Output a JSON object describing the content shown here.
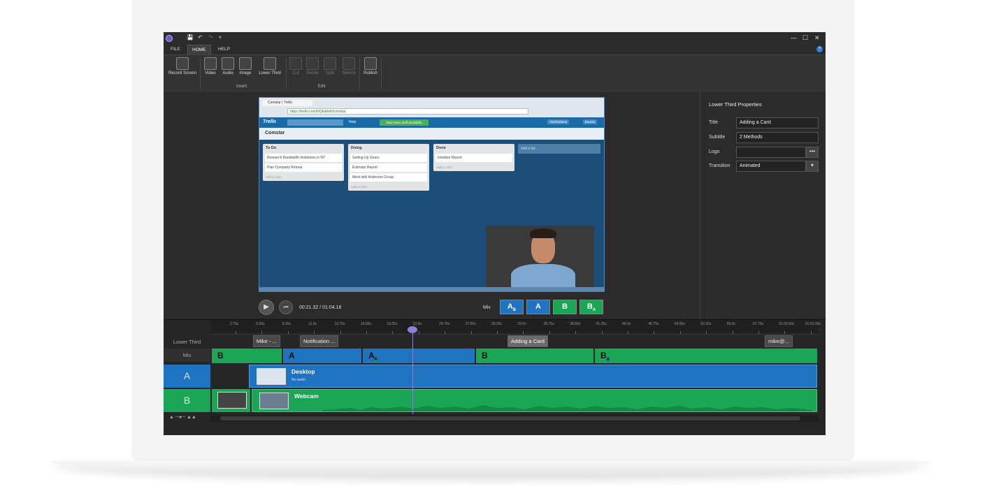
{
  "window": {
    "quick_access": [
      "💾",
      "↶",
      "↷",
      "▾"
    ],
    "controls": {
      "minimize": "—",
      "maximize": "☐",
      "close": "✕"
    }
  },
  "menu": {
    "file": "FILE",
    "home": "HOME",
    "help": "HELP",
    "help_icon": "?"
  },
  "ribbon": {
    "record_screen": "Record Screen",
    "video": "Video",
    "audio": "Audio",
    "image": "Image",
    "lower_third": "Lower Third",
    "cut": "Cut",
    "delete": "Delete",
    "split": "Split",
    "silence": "Silence",
    "publish": "Publish",
    "group_insert": "Insert",
    "group_edit": "Edit"
  },
  "preview": {
    "browser_tab": "Comstar | Trello",
    "url": "https://trello.com/b/QkddelIi/comstar",
    "trello_logo": "Trello",
    "help": "Help",
    "start_badge": "Start (New stuff available)",
    "notifications": "Notifications",
    "boards": "Boards",
    "board_name": "Comstar",
    "lists": [
      {
        "title": "To Do",
        "cards": [
          "Research Bandwidth limitations in NY",
          "Plan Company Retreat"
        ],
        "add": "Add a card..."
      },
      {
        "title": "Doing",
        "cards": [
          "Setting Up Gears",
          "Estimate Report",
          "Meet with Anderson Group"
        ],
        "add": "Add a card..."
      },
      {
        "title": "Done",
        "cards": [
          "Initiative Report"
        ],
        "add": "Add a card..."
      }
    ],
    "add_list": "Add a list..."
  },
  "transport": {
    "play_icon": "▶",
    "skip_icon": "⏮",
    "timecode": "00:21.32 / 01:04.18",
    "mix_label": "Mix",
    "mix_buttons": [
      {
        "main": "A",
        "sub": "B"
      },
      {
        "main": "A",
        "sub": ""
      },
      {
        "main": "B",
        "sub": ""
      },
      {
        "main": "B",
        "sub": "A"
      }
    ]
  },
  "properties": {
    "heading": "Lower Third Properties",
    "title_label": "Title",
    "title_value": "Adding a Card",
    "subtitle_label": "Subtitle",
    "subtitle_value": "2 Methods",
    "logo_label": "Logo",
    "logo_value": "",
    "logo_browse": "•••",
    "transition_label": "Transition",
    "transition_value": "Animated",
    "dropdown_arrow": "▾"
  },
  "timeline": {
    "ticks": [
      "2.75s",
      "5.50s",
      "8.25s",
      "11.0s",
      "13.75s",
      "16.50s",
      "19.25s",
      "22.0s",
      "24.75s",
      "27.50s",
      "30.25s",
      "33.0s",
      "35.75s",
      "38.50s",
      "41.25s",
      "44.0s",
      "46.75s",
      "49.50s",
      "52.25s",
      "55.0s",
      "57.75s",
      "01:00.50s",
      "01:03.25s"
    ],
    "lower_third_label": "Lower Third",
    "mix_label": "Mix",
    "track_a_label": "A",
    "track_b_label": "B",
    "lower_third_clips": [
      "Mike - ...",
      "Notification ...",
      "Adding a Card",
      "mike@..."
    ],
    "mix_segments": [
      "B",
      "A",
      "A",
      "B",
      "B"
    ],
    "mix_segment_subs": [
      "",
      "",
      "B",
      "",
      "A"
    ],
    "clip_a_title": "Desktop",
    "clip_a_subtitle": "No audio",
    "clip_b_title": "Webcam",
    "zoom": "▲ ─●─ ▲▲"
  },
  "colors": {
    "track_a": "#1e74c0",
    "track_b": "#1aa655",
    "playhead": "#8a80d8"
  }
}
